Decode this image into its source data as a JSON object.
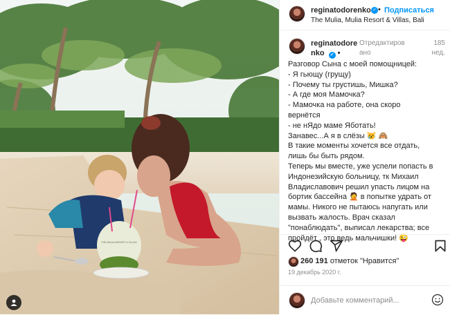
{
  "header": {
    "username": "reginatodorenko",
    "verified": true,
    "separator": "•",
    "follow_label": "Подписаться",
    "location": "The Mulia, Mulia Resort & Villas, Bali"
  },
  "photo": {
    "coconut_text": "THE MULIA RESORT & VILLAS"
  },
  "caption": {
    "username_line1": "reginatodore",
    "username_line2": "nko",
    "edited_line1": "Отредактиров",
    "edited_line2": "ано",
    "time_line1": "185",
    "time_line2": "нед.",
    "lines": [
      "Разговор Сына с моей помощницей:",
      "- Я гьющу (грущу)",
      "- Почему ты грустишь, Мишка?",
      "- А где моя Мамочка?",
      "- Мамочка на работе, она скоро",
      "вернётся",
      "- не нЯдо маме Яботать!",
      "Занавес...А я в слёзы 😿 🙈",
      "В такие моменты хочется все отдать,",
      "лишь бы быть рядом.",
      "Теперь мы вместе, уже успели попасть в",
      "Индонезийскую больницу, тк Михаил",
      "Владиславович решил упасть лицом на",
      "бортик бассейна 🤦 в попытке удрать от",
      "мамы. Никого не пытаюсь напугать или",
      "вызвать жалость. Врач сказал",
      "\"понаблюдать\", выписал лекарства; все",
      "пройдёт , это ведь мальчишки! 😜"
    ]
  },
  "icons": {
    "like": "heart-icon",
    "comment": "comment-icon",
    "share": "send-icon",
    "save": "bookmark-icon",
    "emoji": "smiley-icon"
  },
  "likes": {
    "count": "260 191",
    "text": "отметок \"Нравится\""
  },
  "date": "19 декабрь 2020 г.",
  "comment_box": {
    "placeholder": "Добавьте комментарий..."
  },
  "colors": {
    "accent": "#0095f6",
    "text": "#262626",
    "muted": "#8e8e8e"
  }
}
